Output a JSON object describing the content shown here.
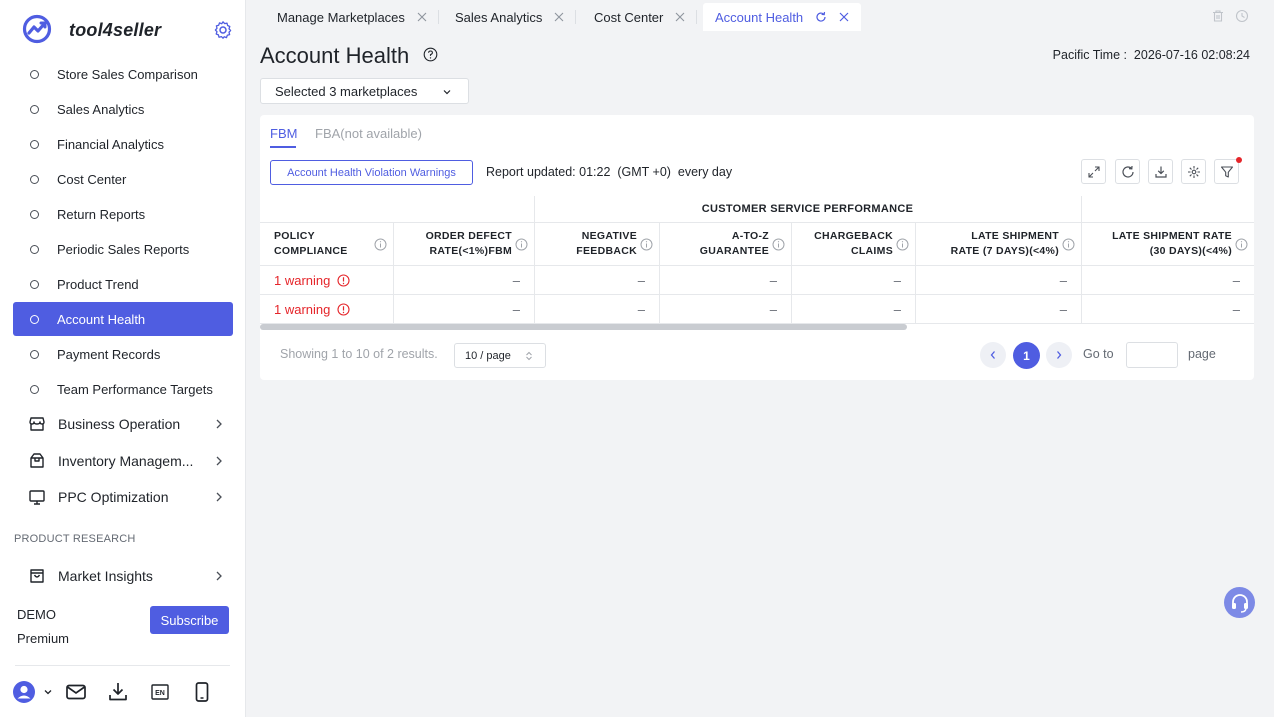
{
  "brand": {
    "name": "tool4seller"
  },
  "sidebar": {
    "items": [
      {
        "label": "Store Sales Comparison"
      },
      {
        "label": "Sales Analytics"
      },
      {
        "label": "Financial Analytics"
      },
      {
        "label": "Cost Center"
      },
      {
        "label": "Return Reports"
      },
      {
        "label": "Periodic Sales Reports"
      },
      {
        "label": "Product Trend"
      },
      {
        "label": "Account Health",
        "active": true
      },
      {
        "label": "Payment Records"
      },
      {
        "label": "Team Performance Targets"
      }
    ],
    "groups": [
      {
        "label": "Business Operation",
        "icon": "store-icon"
      },
      {
        "label": "Inventory Managem...",
        "icon": "box-icon"
      },
      {
        "label": "PPC Optimization",
        "icon": "monitor-icon"
      }
    ],
    "section_label": "PRODUCT RESEARCH",
    "research_groups": [
      {
        "label": "Market Insights",
        "icon": "shopping-bag-icon"
      }
    ],
    "user": {
      "name": "DEMO",
      "plan": "Premium",
      "subscribe_label": "Subscribe"
    },
    "bottom_icons": [
      "avatar-icon",
      "mail-icon",
      "download-icon",
      "language-en-icon",
      "mobile-icon"
    ]
  },
  "tabs": [
    {
      "label": "Manage Marketplaces"
    },
    {
      "label": "Sales Analytics"
    },
    {
      "label": "Cost Center"
    },
    {
      "label": "Account Health",
      "active": true
    }
  ],
  "header": {
    "title": "Account Health",
    "pacific_time": "Pacific Time :  2026-07-16 02:08:24",
    "marketplace_select": "Selected 3 marketplaces"
  },
  "card": {
    "sub_tabs": [
      {
        "label": "FBM",
        "active": true
      },
      {
        "label": "FBA(not available)",
        "disabled": true
      }
    ],
    "violation_button": "Account Health Violation Warnings",
    "report_updated": "Report updated: 01:22  (GMT +0)  every day",
    "toolbar_icons": [
      "expand-icon",
      "refresh-icon",
      "export-icon",
      "columns-settings-icon",
      "filter-icon"
    ]
  },
  "table": {
    "group_header": "CUSTOMER SERVICE PERFORMANCE",
    "columns": [
      {
        "line1": "POLICY",
        "line2": "COMPLIANCE"
      },
      {
        "line1": "ORDER DEFECT",
        "line2": "RATE(<1%)FBM"
      },
      {
        "line1": "NEGATIVE",
        "line2": "FEEDBACK"
      },
      {
        "line1": "A-TO-Z",
        "line2": "GUARANTEE"
      },
      {
        "line1": "CHARGEBACK",
        "line2": "CLAIMS"
      },
      {
        "line1": "LATE SHIPMENT",
        "line2": "RATE (7 DAYS)(<4%)"
      },
      {
        "line1": "LATE SHIPMENT RATE",
        "line2": "(30 DAYS)(<4%)"
      }
    ],
    "rows": [
      [
        "1 warning",
        "–",
        "–",
        "–",
        "–",
        "–",
        "–"
      ],
      [
        "1 warning",
        "–",
        "–",
        "–",
        "–",
        "–",
        "–"
      ]
    ]
  },
  "pagination": {
    "showing": "Showing 1 to 10 of 2 results.",
    "page_size": "10 / page",
    "current_page": "1",
    "goto_label": "Go to",
    "page_label": "page"
  },
  "colors": {
    "accent": "#4f5de1",
    "warning": "#e5252a"
  }
}
